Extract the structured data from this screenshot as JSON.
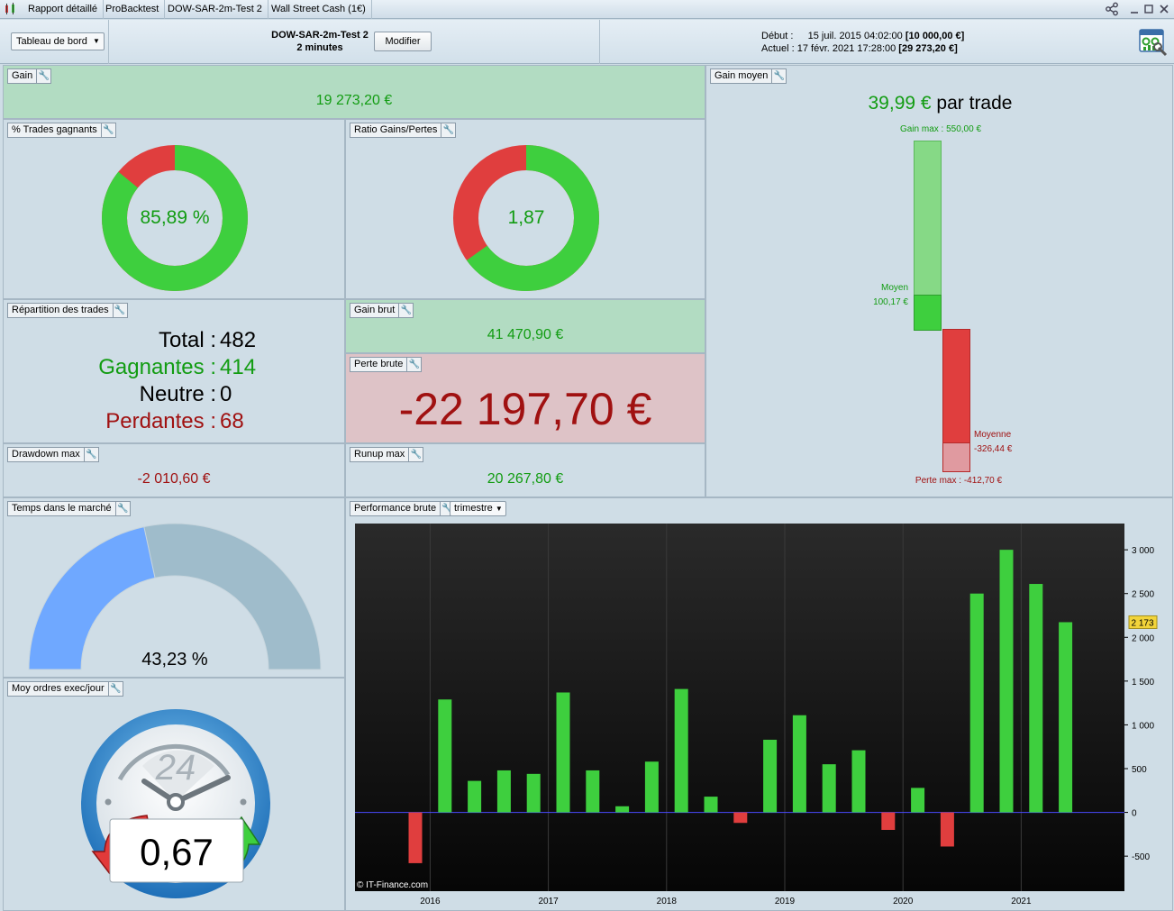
{
  "titlebar": {
    "tabs": [
      "Rapport détaillé",
      "ProBacktest",
      "DOW-SAR-2m-Test 2",
      "Wall Street Cash (1€)"
    ]
  },
  "toolbar": {
    "view_select": "Tableau de bord",
    "system_name": "DOW-SAR-2m-Test 2",
    "timeframe": "2 minutes",
    "modify_button": "Modifier",
    "start_label": "Début :",
    "start_date": "15 juil. 2015 04:02:00",
    "start_capital": "[10 000,00 €]",
    "current_label": "Actuel :",
    "current_date": "17 févr. 2021 17:28:00",
    "current_capital": "[29 273,20 €]"
  },
  "gain": {
    "label": "Gain",
    "value": "19 273,20 €"
  },
  "win_rate": {
    "label": "% Trades gagnants",
    "value": "85,89 %",
    "fraction": 0.8589
  },
  "ratio": {
    "label": "Ratio Gains/Pertes",
    "value": "1,87",
    "fraction": 0.6516
  },
  "avg_gain": {
    "label": "Gain moyen",
    "value": "39,99 €",
    "suffix": "par trade",
    "max_gain_label": "Gain max : 550,00 €",
    "avg_win_label": "Moyen",
    "avg_win_value": "100,17 €",
    "avg_loss_label": "Moyenne",
    "avg_loss_value": "-326,44 €",
    "max_loss_label": "Perte max : -412,70 €"
  },
  "distribution": {
    "label": "Répartition des trades",
    "total_label": "Total :",
    "total": "482",
    "win_label": "Gagnantes :",
    "win": "414",
    "neutral_label": "Neutre :",
    "neutral": "0",
    "loss_label": "Perdantes :",
    "loss": "68"
  },
  "gross_gain": {
    "label": "Gain brut",
    "value": "41 470,90 €"
  },
  "gross_loss": {
    "label": "Perte brute",
    "value": "-22 197,70 €"
  },
  "drawdown": {
    "label": "Drawdown max",
    "value": "-2 010,60 €"
  },
  "runup": {
    "label": "Runup max",
    "value": "20 267,80 €"
  },
  "time_in_market": {
    "label": "Temps dans le marché",
    "value": "43,23 %",
    "fraction": 0.4323
  },
  "orders": {
    "label": "Moy ordres exec/jour",
    "value": "0,67",
    "hours": "24"
  },
  "performance": {
    "label": "Performance brute",
    "period": "trimestre",
    "copyright": "© IT-Finance.com"
  },
  "colors": {
    "win": "#3ecf3e",
    "loss": "#e03e3e",
    "panel": "#cfdde6"
  },
  "chart_data": {
    "type": "bar",
    "x": [
      "2015 Q3",
      "2015 Q4",
      "2016 Q1",
      "2016 Q2",
      "2016 Q3",
      "2016 Q4",
      "2017 Q1",
      "2017 Q2",
      "2017 Q3",
      "2017 Q4",
      "2018 Q1",
      "2018 Q2",
      "2018 Q3",
      "2018 Q4",
      "2019 Q1",
      "2019 Q2",
      "2019 Q3",
      "2019 Q4",
      "2020 Q1",
      "2020 Q2",
      "2020 Q3",
      "2020 Q4",
      "2021 Q1"
    ],
    "values": [
      -580,
      1290,
      360,
      480,
      440,
      1370,
      480,
      70,
      580,
      1410,
      180,
      -120,
      830,
      1110,
      550,
      710,
      -200,
      280,
      -390,
      2500,
      3000,
      2610,
      2173
    ],
    "xticks": [
      "2016",
      "2017",
      "2018",
      "2019",
      "2020",
      "2021"
    ],
    "yticks": [
      "3 000",
      "2 500",
      "2 000",
      "1 500",
      "1 000",
      "500",
      "0",
      "-500"
    ],
    "ylim": [
      -900,
      3300
    ],
    "last_value_label": "2 173"
  }
}
